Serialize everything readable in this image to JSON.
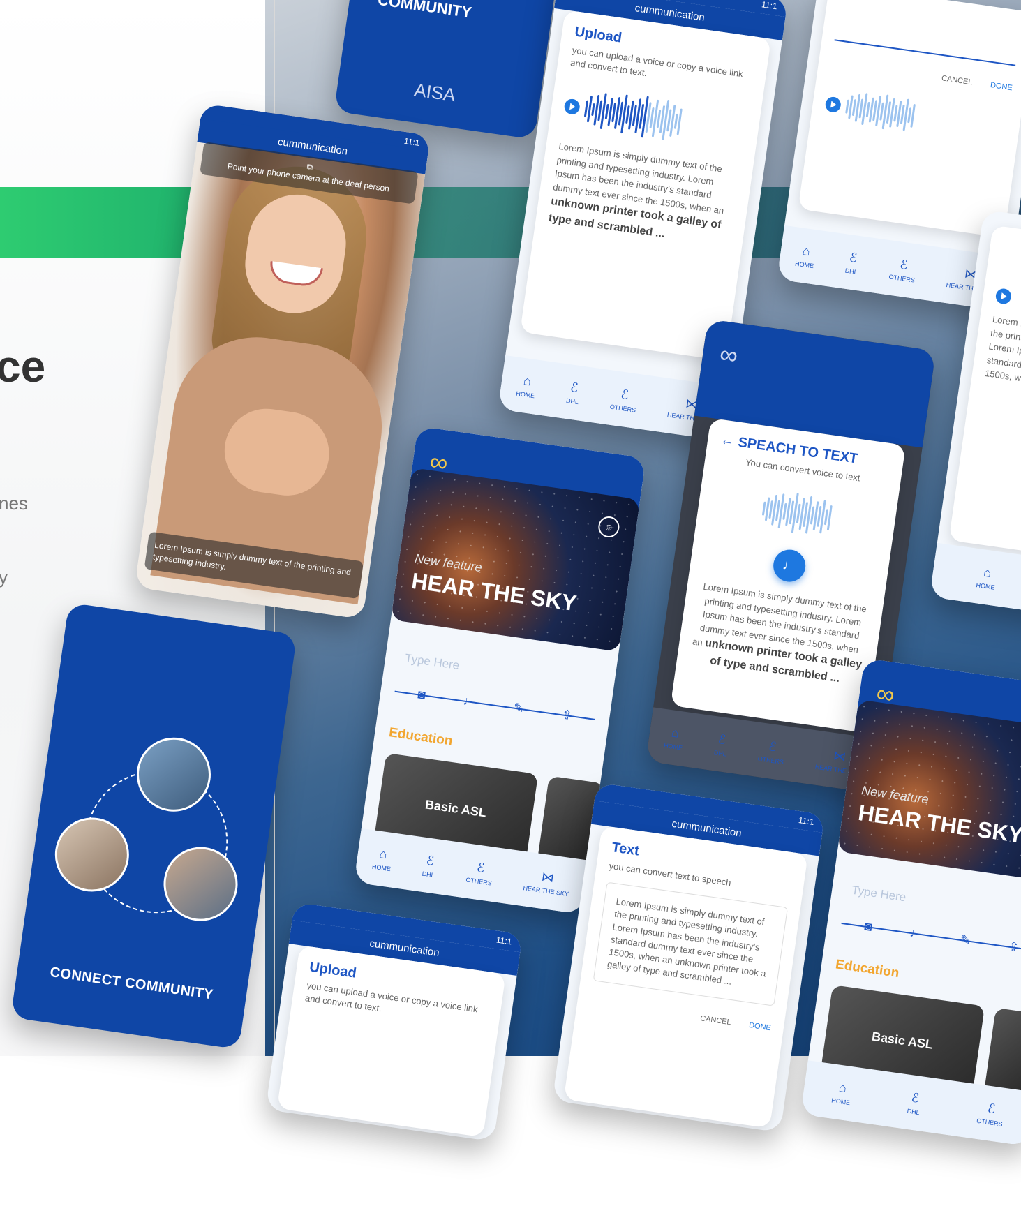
{
  "left": {
    "heading_fragment": "ce",
    "text_fragment_1": "nes",
    "text_fragment_2": "y"
  },
  "app": {
    "title": "cummunication",
    "status_time": "11:1",
    "logo_text": "AISA",
    "logo_glyph": "∞"
  },
  "upload": {
    "title": "Upload",
    "subtitle": "you can upload a voice or copy a voice link and convert to text.",
    "lorem": "Lorem Ipsum is simply dummy text of the printing and typesetting industry. Lorem Ipsum has been the industry's standard dummy text ever since the 1500s, when an",
    "lorem_bold": "unknown printer took a galley of type and scrambled ..."
  },
  "dialog": {
    "cancel_label": "CANCEL",
    "done_label": "DONE"
  },
  "camera": {
    "prompt": "Point your phone camera at the deaf person",
    "caption": "Lorem Ipsum is simply dummy text of the printing and typesetting industry."
  },
  "home": {
    "new_feature": "New feature",
    "hero_title": "HEAR THE SKY",
    "type_placeholder": "Type Here",
    "education_label": "Education",
    "asl_label": "Basic ASL"
  },
  "speech": {
    "title": "SPEACH TO TEXT",
    "subtitle": "You can convert voice to text",
    "lorem": "Lorem Ipsum is simply dummy text of the printing and typesetting industry. Lorem Ipsum has been the industry's standard dummy text ever since the 1500s, when an",
    "lorem_bold": "unknown printer took a galley of type and scrambled ..."
  },
  "text_screen": {
    "title": "Text",
    "subtitle": "you can convert text to speech",
    "body": "Lorem Ipsum is simply dummy text of the printing and typesetting industry. Lorem Ipsum has been the industry's standard dummy text ever since the 1500s, when an unknown printer took a galley of type and scrambled ..."
  },
  "community": {
    "label": "CONNECT COMMUNITY",
    "top_label": "COMMUNITY"
  },
  "nav": {
    "home": "HOME",
    "dhl": "DHL",
    "others": "OTHERS",
    "hear": "HEAR THE SKY"
  },
  "colors": {
    "primary": "#0f46a6",
    "accent": "#1e78e0",
    "education": "#f2a630",
    "green_band": "#2ecc71"
  },
  "icons": [
    "home-icon",
    "ear-icon",
    "sky-icon",
    "camera-icon",
    "mic-icon",
    "pen-icon",
    "upload-icon",
    "play-icon",
    "back-arrow-icon",
    "user-avatar-icon"
  ]
}
